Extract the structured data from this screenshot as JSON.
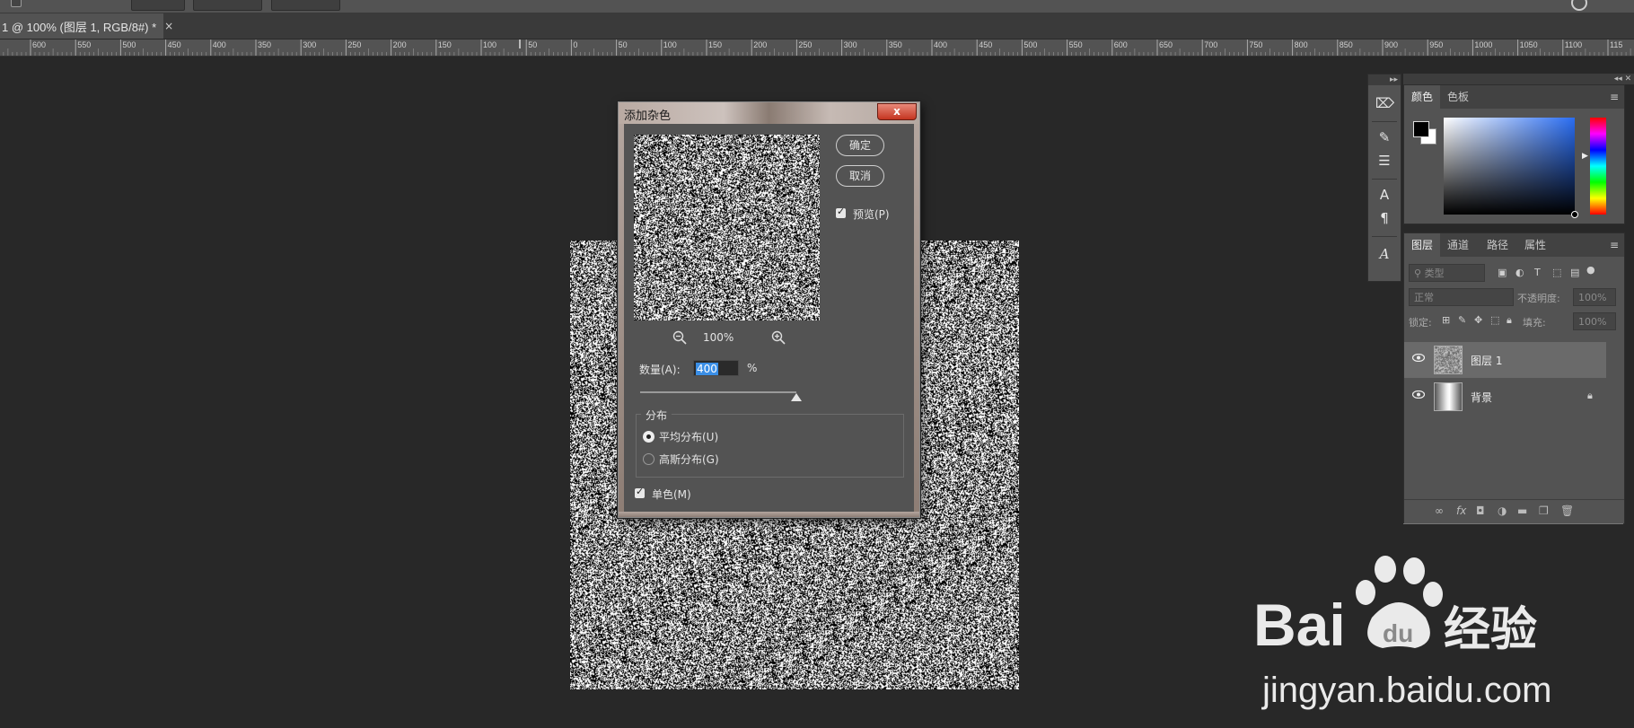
{
  "document_tab": {
    "title": "1 @ 100% (图层 1, RGB/8#) *",
    "close": "×"
  },
  "ruler": {
    "labels": [
      "600",
      "550",
      "500",
      "450",
      "400",
      "350",
      "300",
      "250",
      "200",
      "150",
      "100",
      "50",
      "0",
      "50",
      "100",
      "150",
      "200",
      "250",
      "300",
      "350",
      "400",
      "450",
      "500",
      "550",
      "600",
      "650",
      "700",
      "750",
      "800",
      "850",
      "900",
      "950",
      "1000",
      "1050",
      "1100",
      "115"
    ]
  },
  "dialog": {
    "title": "添加杂色",
    "close_symbol": "x",
    "ok_label": "确定",
    "cancel_label": "取消",
    "preview_label": "预览(P)",
    "zoom_level": "100%",
    "amount_label": "数量(A):",
    "amount_value": "400",
    "amount_unit": "%",
    "distribution_title": "分布",
    "uniform_label": "平均分布(U)",
    "gaussian_label": "高斯分布(G)",
    "monochromatic_label": "单色(M)",
    "preview_checked": true,
    "uniform_selected": true,
    "monochromatic_checked": true
  },
  "color_panel": {
    "tabs": [
      "颜色",
      "色板"
    ],
    "foreground": "#000000",
    "background": "#ffffff"
  },
  "layers_panel": {
    "tabs": [
      "图层",
      "通道",
      "路径",
      "属性"
    ],
    "filter_placeholder": "类型",
    "blend_mode": "正常",
    "opacity_label": "不透明度:",
    "opacity_value": "100%",
    "lock_label": "锁定:",
    "fill_label": "填充:",
    "fill_value": "100%",
    "layers": [
      {
        "name": "图层 1",
        "selected": true
      },
      {
        "name": "背景",
        "locked": true
      }
    ]
  },
  "watermark": {
    "brand": "Bai",
    "du": "du",
    "jingyan": "经验",
    "url": "jingyan.baidu.com"
  }
}
